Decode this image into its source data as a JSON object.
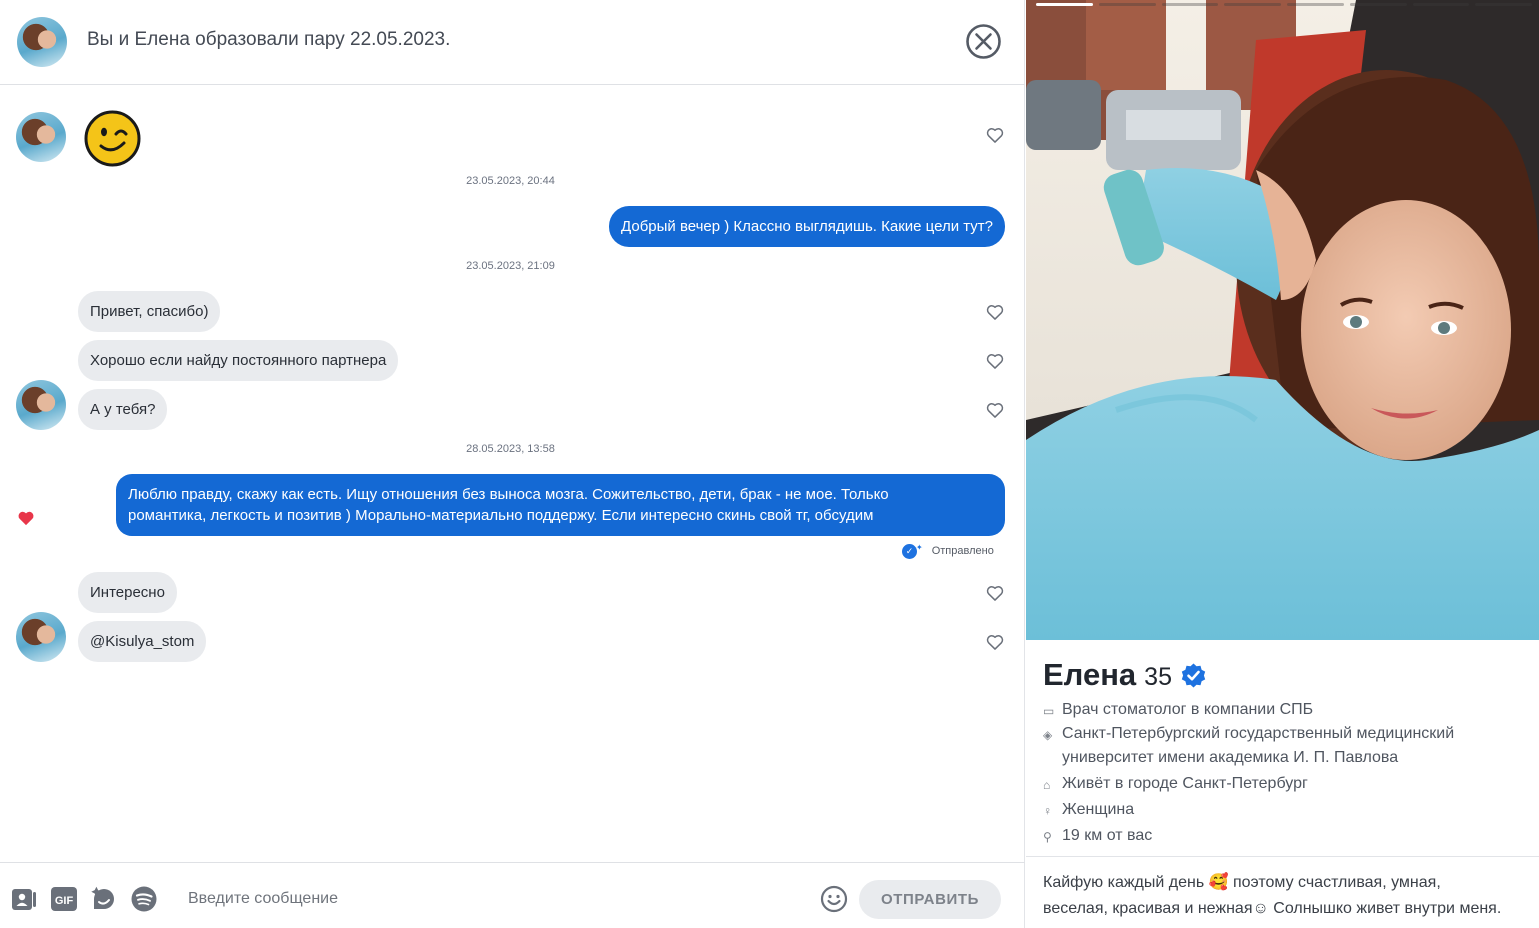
{
  "header": {
    "title": "Вы и Елена образовали пару 22.05.2023."
  },
  "messages": [
    {
      "type": "emoji",
      "emoji": "wink-emoji"
    },
    {
      "type": "timestamp",
      "text": "23.05.2023, 20:44"
    },
    {
      "type": "outgoing",
      "text": "Добрый вечер ) Классно выглядишь. Какие цели тут?"
    },
    {
      "type": "timestamp",
      "text": "23.05.2023, 21:09"
    },
    {
      "type": "incoming",
      "text": "Привет, спасибо)"
    },
    {
      "type": "incoming",
      "text": "Хорошо если найду постоянного партнера"
    },
    {
      "type": "incoming",
      "text": "А у тебя?"
    },
    {
      "type": "timestamp",
      "text": "28.05.2023, 13:58"
    },
    {
      "type": "outgoing",
      "liked": true,
      "text_line1": "Люблю правду, скажу как есть. Ищу отношения без выноса мозга. Сожительство, дети, брак - не мое. Только",
      "text_line2": "романтика, легкость и позитив ) Морально-материально поддержу. Если интересно скинь свой тг, обсудим",
      "status": "Отправлено"
    },
    {
      "type": "incoming",
      "text": "Интересно"
    },
    {
      "type": "incoming",
      "text": "@Kisulya_stom"
    }
  ],
  "composer": {
    "placeholder": "Введите сообщение",
    "send_label": "ОТПРАВИТЬ",
    "gif_label": "GIF"
  },
  "profile": {
    "name": "Елена",
    "age": "35",
    "job": "Врач стоматолог в компании СПБ",
    "school_line1": "Санкт-Петербургский государственный медицинский",
    "school_line2": "университет имени академика И. П. Павлова",
    "city": "Живёт в городе Санкт-Петербург",
    "gender": "Женщина",
    "distance": "19 км от вас",
    "bio_line1": "Кайфую каждый день 🥰 поэтому счастливая, умная,",
    "bio_line2": "веселая, красивая и нежная☺ Солнышко живет внутри меня.",
    "photo_count": 8,
    "active_photo": 1
  },
  "colors": {
    "outgoing_bubble": "#1469d4",
    "incoming_bubble": "#e9ebee",
    "liked_heart": "#e8364a",
    "verified": "#1e72e0"
  }
}
